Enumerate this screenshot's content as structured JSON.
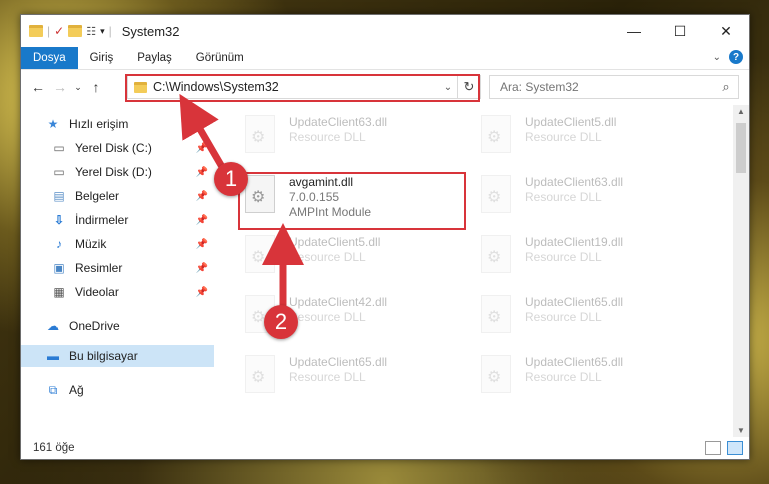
{
  "window": {
    "title": "System32"
  },
  "ribbon": {
    "tabs": [
      "Dosya",
      "Giriş",
      "Paylaş",
      "Görünüm"
    ]
  },
  "address": {
    "path": "C:\\Windows\\System32"
  },
  "search": {
    "placeholder": "Ara: System32"
  },
  "sidebar": {
    "items": [
      {
        "label": "Hızlı erişim",
        "icon": "star-icon",
        "pinned": false
      },
      {
        "label": "Yerel Disk (C:)",
        "icon": "drive-icon",
        "pinned": true
      },
      {
        "label": "Yerel Disk (D:)",
        "icon": "drive-icon",
        "pinned": true
      },
      {
        "label": "Belgeler",
        "icon": "documents-icon",
        "pinned": true
      },
      {
        "label": "İndirmeler",
        "icon": "download-icon",
        "pinned": true
      },
      {
        "label": "Müzik",
        "icon": "music-icon",
        "pinned": true
      },
      {
        "label": "Resimler",
        "icon": "pictures-icon",
        "pinned": true
      },
      {
        "label": "Videolar",
        "icon": "videos-icon",
        "pinned": true
      },
      {
        "label": "OneDrive",
        "icon": "cloud-icon",
        "pinned": false
      },
      {
        "label": "Bu bilgisayar",
        "icon": "computer-icon",
        "pinned": false
      },
      {
        "label": "Ağ",
        "icon": "network-icon",
        "pinned": false
      }
    ]
  },
  "files": [
    {
      "name": "UpdateClient63.dll",
      "desc": "Resource DLL",
      "faded": true
    },
    {
      "name": "UpdateClient5.dll",
      "desc": "Resource DLL",
      "faded": true
    },
    {
      "name": "avgamint.dll",
      "version": "7.0.0.155",
      "desc": "AMPInt Module",
      "faded": false
    },
    {
      "name": "UpdateClient63.dll",
      "desc": "Resource DLL",
      "faded": true
    },
    {
      "name": "UpdateClient5.dll",
      "desc": "Resource DLL",
      "faded": true
    },
    {
      "name": "UpdateClient19.dll",
      "desc": "Resource DLL",
      "faded": true
    },
    {
      "name": "UpdateClient42.dll",
      "desc": "Resource DLL",
      "faded": true
    },
    {
      "name": "UpdateClient65.dll",
      "desc": "Resource DLL",
      "faded": true
    },
    {
      "name": "UpdateClient65.dll",
      "desc": "Resource DLL",
      "faded": true
    },
    {
      "name": "UpdateClient65.dll",
      "desc": "Resource DLL",
      "faded": true
    }
  ],
  "status": {
    "count": "161 öğe"
  },
  "callouts": [
    "1",
    "2"
  ],
  "colors": {
    "accent": "#1979ca",
    "highlight": "#d8343a",
    "selection": "#cce4f7"
  }
}
